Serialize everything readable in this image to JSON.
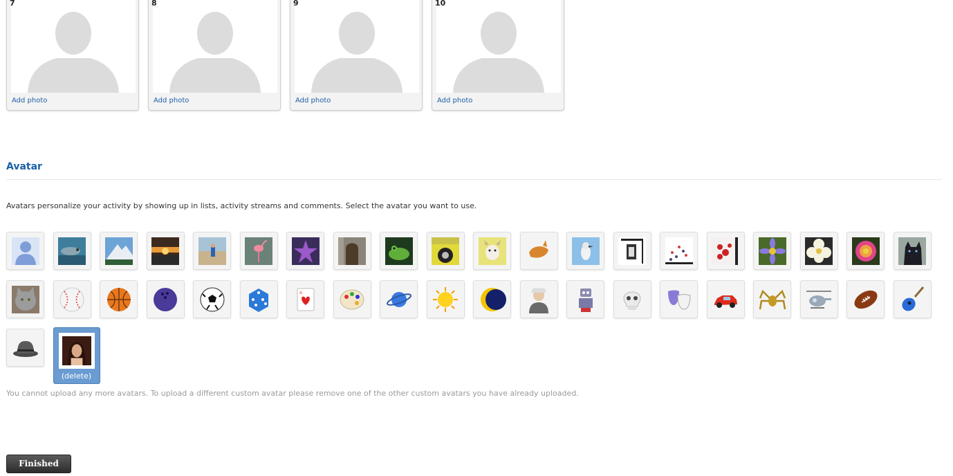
{
  "photos": [
    {
      "number": "7",
      "link": "Add photo"
    },
    {
      "number": "8",
      "link": "Add photo"
    },
    {
      "number": "9",
      "link": "Add photo"
    },
    {
      "number": "10",
      "link": "Add photo"
    }
  ],
  "avatar_section": {
    "title": "Avatar",
    "description": "Avatars personalize your activity by showing up in lists, activity streams and comments. Select the avatar you want to use.",
    "rows": [
      [
        "default-person",
        "dolphin",
        "mountain",
        "sunset",
        "beach-child",
        "flamingo",
        "starfish",
        "stone-door",
        "frog",
        "car-wheel",
        "dog",
        "fox",
        "bird",
        "lantern",
        "dots",
        "red-berries",
        "purple-flower",
        "white-flower",
        "pink-flower",
        "black-cat"
      ],
      [
        "gray-cat",
        "baseball",
        "basketball",
        "bowling-ball",
        "soccer-ball",
        "dice",
        "playing-card",
        "paint-palette",
        "planet",
        "sun",
        "moon",
        "scientist",
        "robot",
        "skull",
        "theater-masks",
        "red-car",
        "spider",
        "helicopter",
        "football",
        "guitar"
      ],
      [
        "hat"
      ]
    ],
    "custom_avatar": {
      "icon": "custom-photo",
      "delete_label": "(delete)"
    },
    "upload_note": "You cannot upload any more avatars.  To upload a different custom avatar please remove one of the other custom avatars you have already uploaded."
  },
  "finished_label": "Finished",
  "colors": {
    "link": "#1f5fa8",
    "title": "#1a61a8",
    "selected": "#6a9bd1"
  }
}
